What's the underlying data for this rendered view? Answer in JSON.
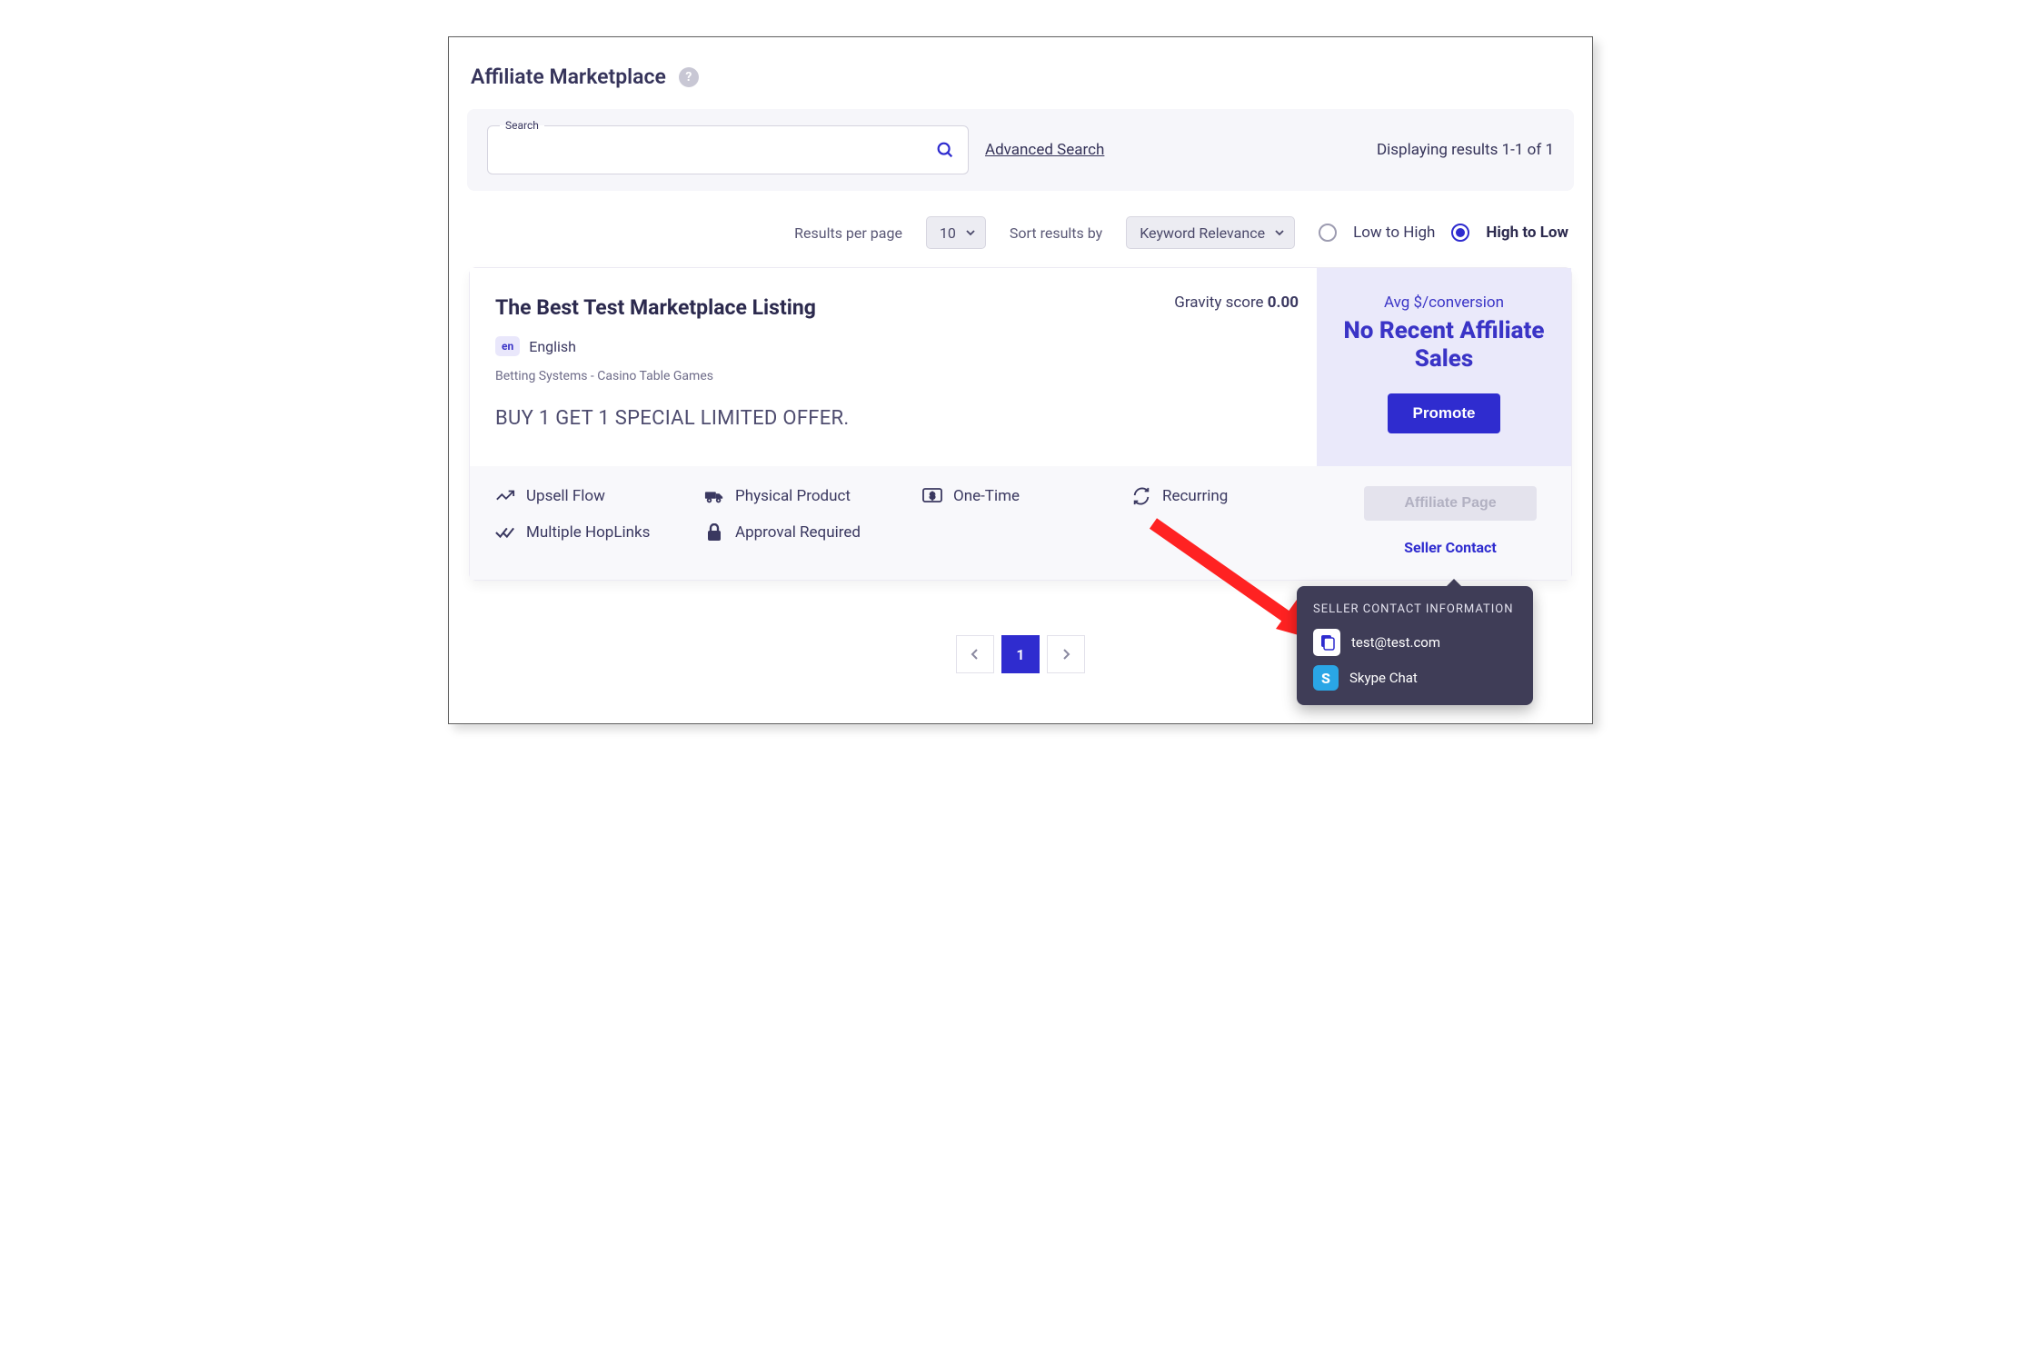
{
  "header": {
    "title": "Affiliate Marketplace",
    "help_glyph": "?"
  },
  "search": {
    "label": "Search",
    "advanced_link": "Advanced Search",
    "results_text": "Displaying results 1-1 of 1"
  },
  "controls": {
    "per_page_label": "Results per page",
    "per_page_value": "10",
    "sort_label": "Sort results by",
    "sort_value": "Keyword Relevance",
    "radio_low": "Low to High",
    "radio_high": "High to Low"
  },
  "listing": {
    "title": "The Best Test Marketplace Listing",
    "gravity_label": "Gravity score ",
    "gravity_value": "0.00",
    "lang_code": "en",
    "lang_name": "English",
    "category": "Betting Systems - Casino Table Games",
    "offer": "BUY 1 GET 1 SPECIAL LIMITED OFFER.",
    "avg_label": "Avg $/conversion",
    "no_sales": "No Recent Affiliate Sales",
    "promote": "Promote",
    "tags": {
      "upsell": "Upsell Flow",
      "physical": "Physical Product",
      "onetime": "One-Time",
      "recurring": "Recurring",
      "multihop": "Multiple HopLinks",
      "approval": "Approval Required"
    },
    "affiliate_page": "Affiliate Page",
    "seller_contact": "Seller Contact"
  },
  "tooltip": {
    "title": "SELLER CONTACT INFORMATION",
    "email": "test@test.com",
    "skype": "Skype Chat",
    "skype_glyph": "S"
  },
  "pagination": {
    "page": "1"
  }
}
